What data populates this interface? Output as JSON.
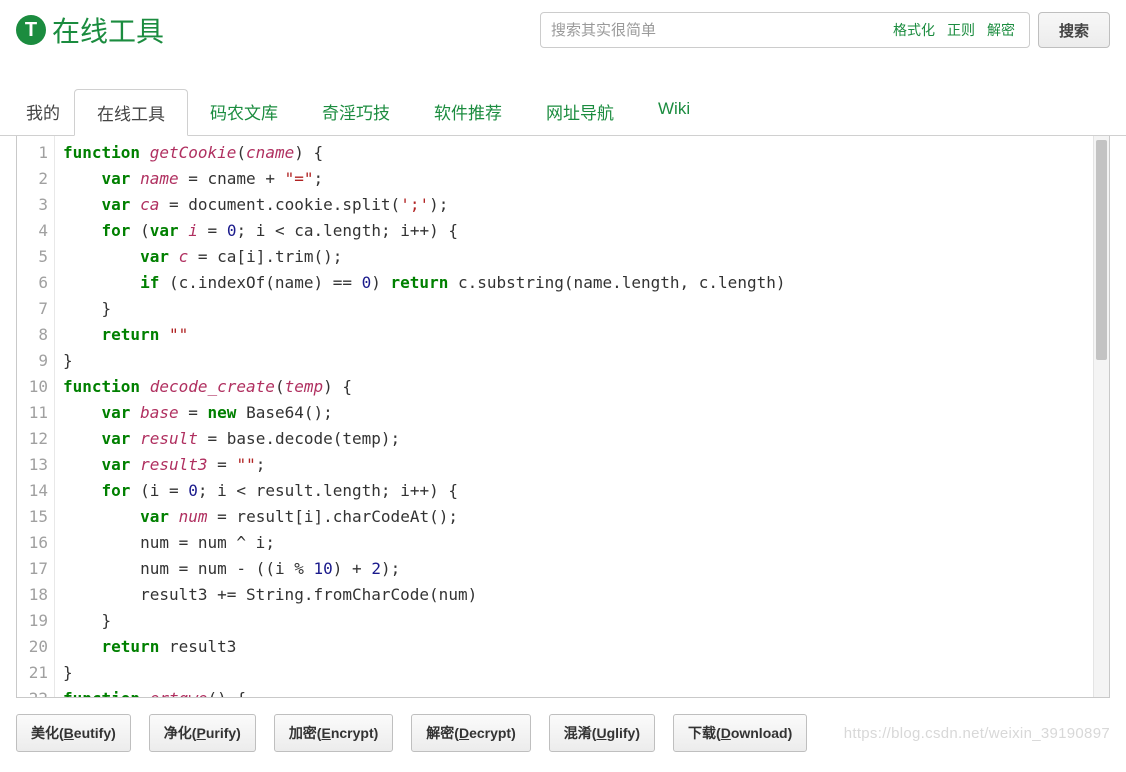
{
  "header": {
    "logo_letter": "T",
    "logo_text": "在线工具",
    "search_placeholder": "搜索其实很简单",
    "search_tags": [
      "格式化",
      "正则",
      "解密"
    ],
    "search_button": "搜索"
  },
  "tabs": [
    {
      "label": "我的",
      "active": false
    },
    {
      "label": "在线工具",
      "active": true
    },
    {
      "label": "码农文库",
      "active": false
    },
    {
      "label": "奇淫巧技",
      "active": false
    },
    {
      "label": "软件推荐",
      "active": false
    },
    {
      "label": "网址导航",
      "active": false
    },
    {
      "label": "Wiki",
      "active": false
    }
  ],
  "editor": {
    "line_count": 22,
    "lines": [
      [
        [
          "kw",
          "function"
        ],
        [
          "sp",
          " "
        ],
        [
          "fn",
          "getCookie"
        ],
        [
          "op",
          "("
        ],
        [
          "var",
          "cname"
        ],
        [
          "op",
          ") {"
        ]
      ],
      [
        [
          "sp",
          "    "
        ],
        [
          "kw",
          "var"
        ],
        [
          "sp",
          " "
        ],
        [
          "var",
          "name"
        ],
        [
          "sp",
          " "
        ],
        [
          "op",
          "="
        ],
        [
          "sp",
          " cname "
        ],
        [
          "op",
          "+"
        ],
        [
          "sp",
          " "
        ],
        [
          "str",
          "\"=\""
        ],
        [
          "op",
          ";"
        ]
      ],
      [
        [
          "sp",
          "    "
        ],
        [
          "kw",
          "var"
        ],
        [
          "sp",
          " "
        ],
        [
          "var",
          "ca"
        ],
        [
          "sp",
          " "
        ],
        [
          "op",
          "="
        ],
        [
          "sp",
          " document.cookie.split("
        ],
        [
          "str",
          "';'"
        ],
        [
          "op",
          ");"
        ]
      ],
      [
        [
          "sp",
          "    "
        ],
        [
          "kw",
          "for"
        ],
        [
          "sp",
          " ("
        ],
        [
          "kw",
          "var"
        ],
        [
          "sp",
          " "
        ],
        [
          "var",
          "i"
        ],
        [
          "sp",
          " "
        ],
        [
          "op",
          "="
        ],
        [
          "sp",
          " "
        ],
        [
          "num",
          "0"
        ],
        [
          "op",
          "; i "
        ],
        [
          "op",
          "<"
        ],
        [
          "sp",
          " ca.length; i"
        ],
        [
          "op",
          "++) {"
        ]
      ],
      [
        [
          "sp",
          "        "
        ],
        [
          "kw",
          "var"
        ],
        [
          "sp",
          " "
        ],
        [
          "var",
          "c"
        ],
        [
          "sp",
          " "
        ],
        [
          "op",
          "="
        ],
        [
          "sp",
          " ca[i].trim();"
        ]
      ],
      [
        [
          "sp",
          "        "
        ],
        [
          "kw",
          "if"
        ],
        [
          "sp",
          " (c.indexOf(name) "
        ],
        [
          "op",
          "=="
        ],
        [
          "sp",
          " "
        ],
        [
          "num",
          "0"
        ],
        [
          "op",
          ") "
        ],
        [
          "kw",
          "return"
        ],
        [
          "sp",
          " c.substring(name.length, c.length)"
        ]
      ],
      [
        [
          "sp",
          "    "
        ],
        [
          "op",
          "}"
        ]
      ],
      [
        [
          "sp",
          "    "
        ],
        [
          "kw",
          "return"
        ],
        [
          "sp",
          " "
        ],
        [
          "str",
          "\"\""
        ]
      ],
      [
        [
          "op",
          "}"
        ]
      ],
      [
        [
          "kw",
          "function"
        ],
        [
          "sp",
          " "
        ],
        [
          "fn",
          "decode_create"
        ],
        [
          "op",
          "("
        ],
        [
          "var",
          "temp"
        ],
        [
          "op",
          ") {"
        ]
      ],
      [
        [
          "sp",
          "    "
        ],
        [
          "kw",
          "var"
        ],
        [
          "sp",
          " "
        ],
        [
          "var",
          "base"
        ],
        [
          "sp",
          " "
        ],
        [
          "op",
          "="
        ],
        [
          "sp",
          " "
        ],
        [
          "kw",
          "new"
        ],
        [
          "sp",
          " Base64();"
        ]
      ],
      [
        [
          "sp",
          "    "
        ],
        [
          "kw",
          "var"
        ],
        [
          "sp",
          " "
        ],
        [
          "var",
          "result"
        ],
        [
          "sp",
          " "
        ],
        [
          "op",
          "="
        ],
        [
          "sp",
          " base.decode(temp);"
        ]
      ],
      [
        [
          "sp",
          "    "
        ],
        [
          "kw",
          "var"
        ],
        [
          "sp",
          " "
        ],
        [
          "var",
          "result3"
        ],
        [
          "sp",
          " "
        ],
        [
          "op",
          "="
        ],
        [
          "sp",
          " "
        ],
        [
          "str",
          "\"\""
        ],
        [
          "op",
          ";"
        ]
      ],
      [
        [
          "sp",
          "    "
        ],
        [
          "kw",
          "for"
        ],
        [
          "sp",
          " (i "
        ],
        [
          "op",
          "="
        ],
        [
          "sp",
          " "
        ],
        [
          "num",
          "0"
        ],
        [
          "op",
          "; i "
        ],
        [
          "op",
          "<"
        ],
        [
          "sp",
          " result.length; i"
        ],
        [
          "op",
          "++) {"
        ]
      ],
      [
        [
          "sp",
          "        "
        ],
        [
          "kw",
          "var"
        ],
        [
          "sp",
          " "
        ],
        [
          "var",
          "num"
        ],
        [
          "sp",
          " "
        ],
        [
          "op",
          "="
        ],
        [
          "sp",
          " result[i].charCodeAt();"
        ]
      ],
      [
        [
          "sp",
          "        num "
        ],
        [
          "op",
          "="
        ],
        [
          "sp",
          " num "
        ],
        [
          "op",
          "^"
        ],
        [
          "sp",
          " i;"
        ]
      ],
      [
        [
          "sp",
          "        num "
        ],
        [
          "op",
          "="
        ],
        [
          "sp",
          " num "
        ],
        [
          "op",
          "-"
        ],
        [
          "sp",
          " ((i "
        ],
        [
          "op",
          "%"
        ],
        [
          "sp",
          " "
        ],
        [
          "num",
          "10"
        ],
        [
          "op",
          ") "
        ],
        [
          "op",
          "+"
        ],
        [
          "sp",
          " "
        ],
        [
          "num",
          "2"
        ],
        [
          "op",
          ");"
        ]
      ],
      [
        [
          "sp",
          "        result3 "
        ],
        [
          "op",
          "+="
        ],
        [
          "sp",
          " String.fromCharCode(num)"
        ]
      ],
      [
        [
          "sp",
          "    "
        ],
        [
          "op",
          "}"
        ]
      ],
      [
        [
          "sp",
          "    "
        ],
        [
          "kw",
          "return"
        ],
        [
          "sp",
          " result3"
        ]
      ],
      [
        [
          "op",
          "}"
        ]
      ],
      [
        [
          "kw",
          "function"
        ],
        [
          "sp",
          " "
        ],
        [
          "fn",
          "ertqwe"
        ],
        [
          "op",
          "() {"
        ]
      ]
    ]
  },
  "toolbar": {
    "buttons": [
      {
        "pre": "美化(",
        "u": "B",
        "post": "eutify)"
      },
      {
        "pre": "净化(",
        "u": "P",
        "post": "urify)"
      },
      {
        "pre": "加密(",
        "u": "E",
        "post": "ncrypt)"
      },
      {
        "pre": "解密(",
        "u": "D",
        "post": "ecrypt)"
      },
      {
        "pre": "混淆(",
        "u": "U",
        "post": "glify)"
      },
      {
        "pre": "下载(",
        "u": "D",
        "post": "ownload)"
      }
    ]
  },
  "watermark": "https://blog.csdn.net/weixin_39190897"
}
